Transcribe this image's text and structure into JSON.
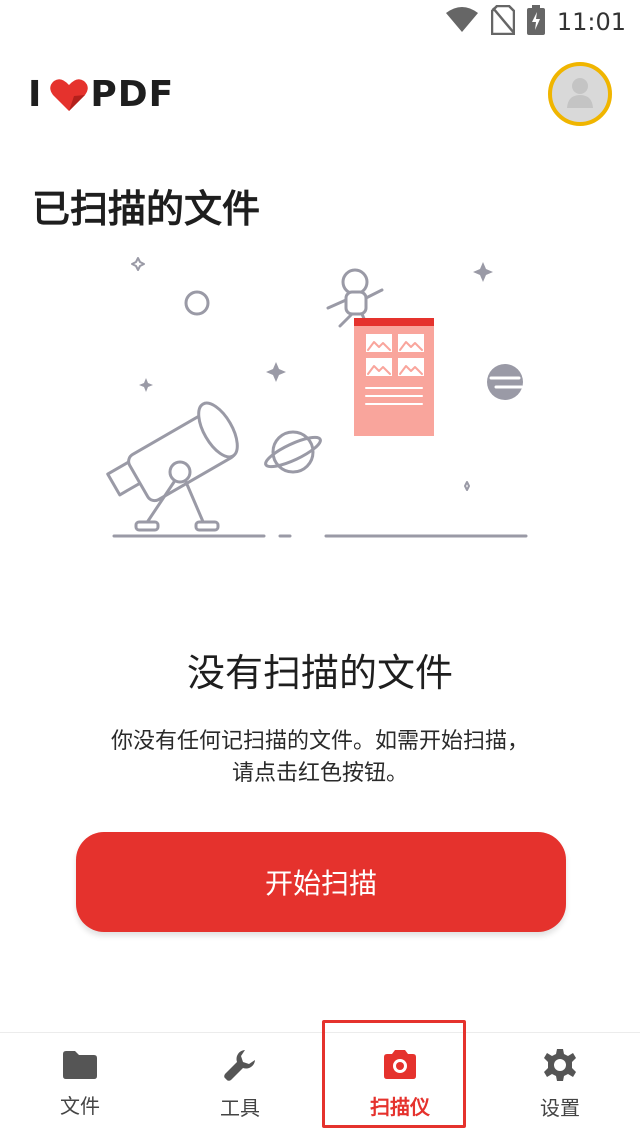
{
  "status_bar": {
    "time": "11:01",
    "icons": [
      "wifi-icon",
      "no-sim-icon",
      "battery-charging-icon"
    ]
  },
  "header": {
    "logo_left": "I",
    "logo_right": "PDF",
    "logo_icon": "heart-icon",
    "avatar_icon": "user-avatar-icon"
  },
  "page": {
    "title": "已扫描的文件"
  },
  "empty_state": {
    "title": "没有扫描的文件",
    "description_line1": "你没有任何记扫描的文件。如需开始扫描，",
    "description_line2": "请点击红色按钮。",
    "illustration": "telescope-space-document-illustration"
  },
  "actions": {
    "start_scan_label": "开始扫描"
  },
  "bottom_nav": {
    "items": [
      {
        "label": "文件",
        "icon": "folder-icon",
        "active": false
      },
      {
        "label": "工具",
        "icon": "wrench-icon",
        "active": false
      },
      {
        "label": "扫描仪",
        "icon": "camera-icon",
        "active": true
      },
      {
        "label": "设置",
        "icon": "gear-icon",
        "active": false
      }
    ]
  },
  "colors": {
    "accent": "#e5322d",
    "avatar_border": "#f0b500",
    "illustration_line": "#9a9aa6",
    "document_fill": "#f9a59c"
  }
}
